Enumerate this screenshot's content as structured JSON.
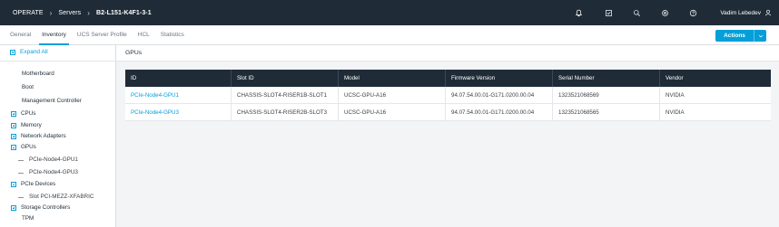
{
  "header": {
    "breadcrumb": [
      "OPERATE",
      "Servers",
      "B2-L151-K4F1-3-1"
    ],
    "user_name": "Vadim Lebedev",
    "icons": [
      "bell-icon",
      "task-icon",
      "search-icon",
      "settings-icon",
      "help-icon",
      "user-icon"
    ]
  },
  "tabs": [
    {
      "label": "General",
      "active": false
    },
    {
      "label": "Inventory",
      "active": true
    },
    {
      "label": "UCS Server Profile",
      "active": false
    },
    {
      "label": "HCL",
      "active": false
    },
    {
      "label": "Statistics",
      "active": false
    }
  ],
  "actions": {
    "label": "Actions"
  },
  "tree": {
    "expand_all": "Expand All",
    "items": [
      {
        "label": "Motherboard",
        "kind": "plain"
      },
      {
        "label": "Boot",
        "kind": "plain"
      },
      {
        "label": "Management Controller",
        "kind": "plain"
      },
      {
        "label": "CPUs",
        "kind": "collapsed"
      },
      {
        "label": "Memory",
        "kind": "collapsed"
      },
      {
        "label": "Network Adapters",
        "kind": "collapsed"
      },
      {
        "label": "GPUs",
        "kind": "expanded"
      },
      {
        "label": "PCIe-Node4-GPU1",
        "kind": "child"
      },
      {
        "label": "PCIe-Node4-GPU3",
        "kind": "child"
      },
      {
        "label": "PCIe Devices",
        "kind": "expanded"
      },
      {
        "label": "Slot PCI-MEZZ-XFABRIC",
        "kind": "child"
      },
      {
        "label": "Storage Controllers",
        "kind": "collapsed"
      },
      {
        "label": "TPM",
        "kind": "plain"
      }
    ]
  },
  "main": {
    "title": "GPUs",
    "table": {
      "columns": [
        "ID",
        "Slot ID",
        "Model",
        "Firmware Version",
        "Serial Number",
        "Vendor"
      ],
      "rows": [
        [
          "PCIe-Node4-GPU1",
          "CHASSIS-SLOT4-RISER1B-SLOT1",
          "UCSC-GPU-A16",
          "94.07.54.00.01-G171.0200.00.04",
          "1323521068569",
          "NVIDIA"
        ],
        [
          "PCIe-Node4-GPU3",
          "CHASSIS-SLOT4-RISER2B-SLOT3",
          "UCSC-GPU-A16",
          "94.07.54.00.01-G171.0200.00.04",
          "1323521068565",
          "NVIDIA"
        ]
      ]
    }
  },
  "colors": {
    "accent": "#049fd9",
    "topbar": "#1f2c38",
    "content_bg": "#f2f4f5"
  }
}
